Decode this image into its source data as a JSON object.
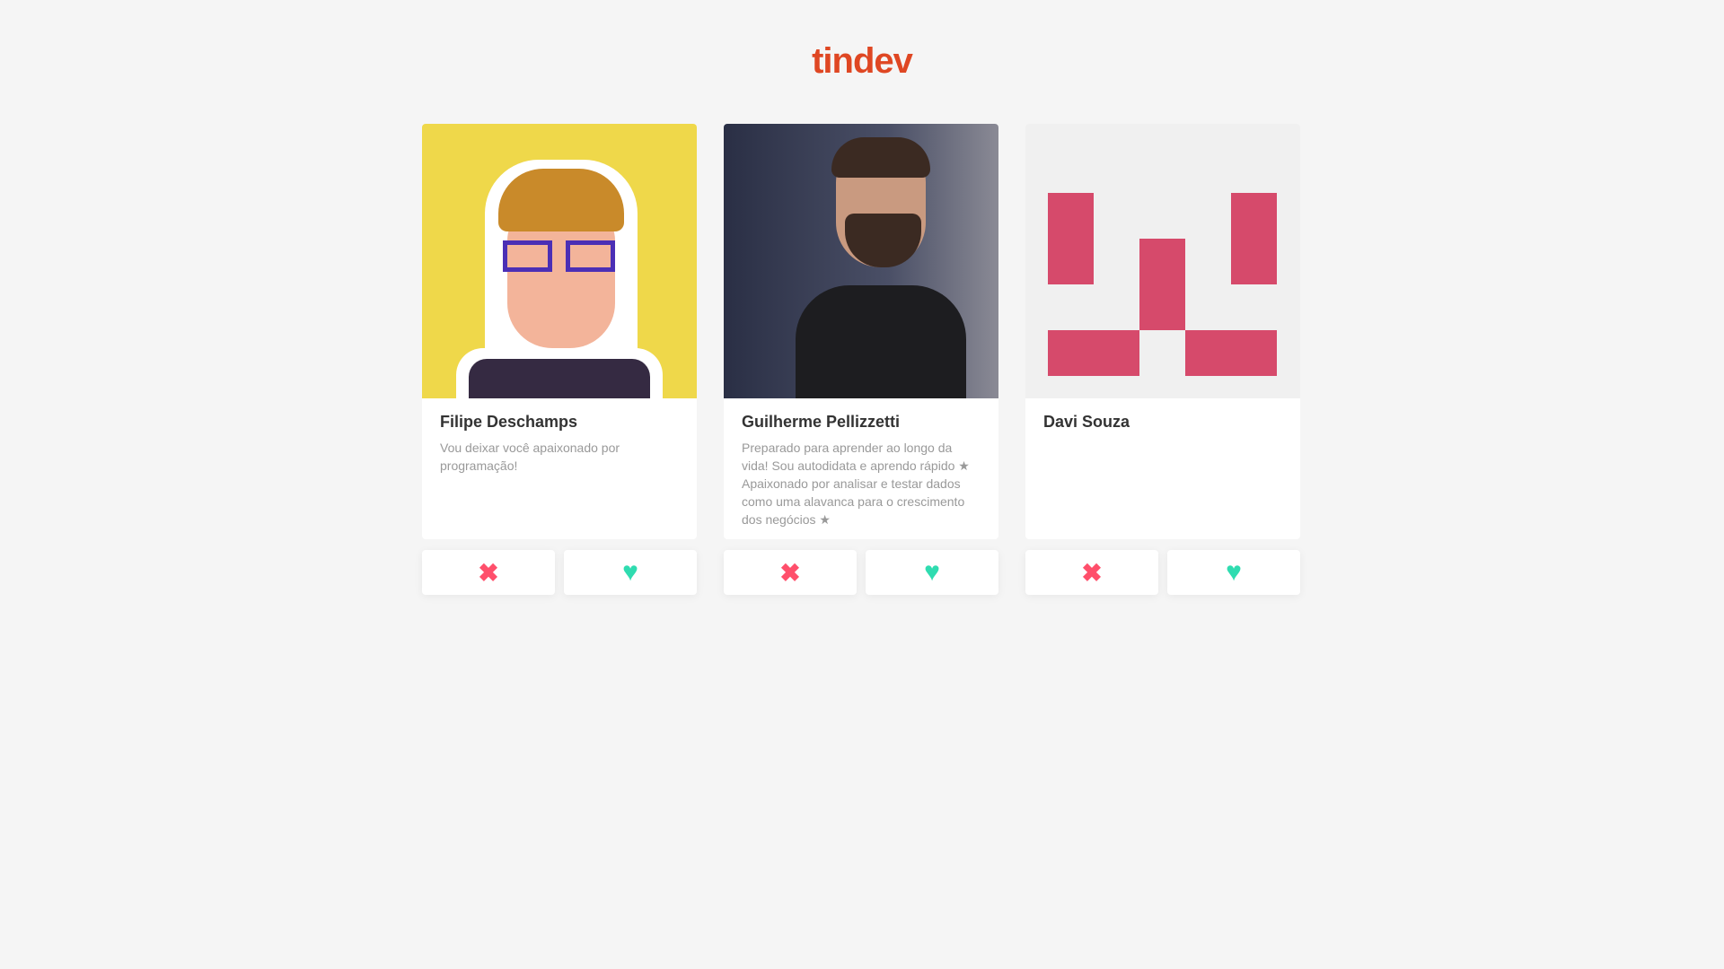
{
  "app": {
    "logo": "tindev"
  },
  "users": [
    {
      "name": "Filipe Deschamps",
      "bio": "Vou deixar você apaixonado por programação!",
      "avatar": "pixel-art-avatar"
    },
    {
      "name": "Guilherme Pellizzetti",
      "bio": "Preparado para aprender ao longo da vida! Sou autodidata e aprendo rápido ★ Apaixonado por analisar e testar dados como uma alavanca para o crescimento dos negócios ★",
      "avatar": "photo"
    },
    {
      "name": "Davi Souza",
      "bio": "",
      "avatar": "identicon"
    }
  ],
  "actions": {
    "dislike": "✖",
    "like": "♥"
  },
  "colors": {
    "brand": "#df4723",
    "dislike": "#ff4f6b",
    "like": "#2fdcb0",
    "identicon": "#d64a6b"
  }
}
